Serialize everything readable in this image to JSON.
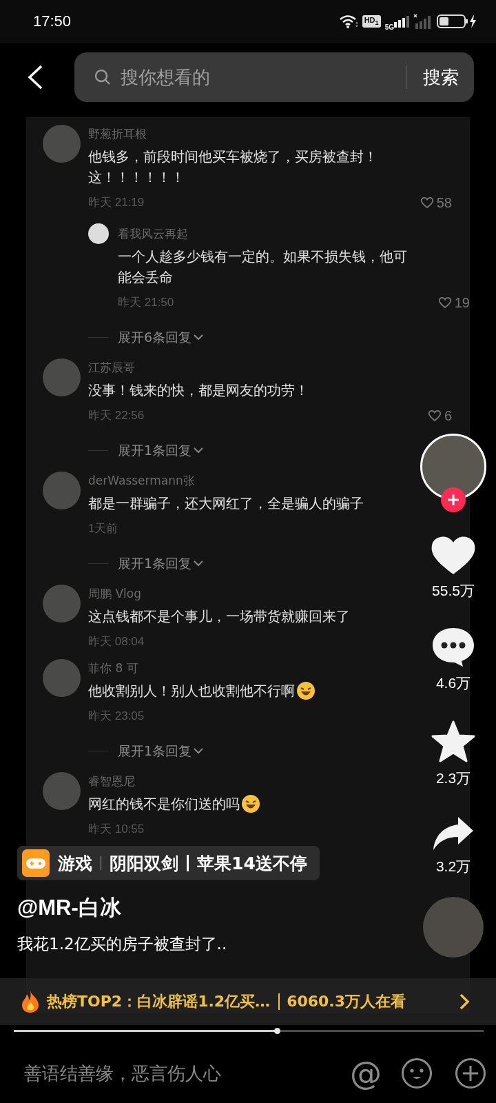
{
  "status_bar": {
    "time": "17:50",
    "hd_badge": "HD$_{1}$",
    "network": "5G"
  },
  "search": {
    "placeholder": "搜你想看的",
    "button": "搜索"
  },
  "comments": [
    {
      "name": "野葱折耳根",
      "text": "他钱多，前段时间他买车被烧了，买房被查封！这！！！！！！",
      "time": "昨天 21:19",
      "likes": "58",
      "replies": [
        {
          "name": "看我风云再起",
          "text": "一个人趁多少钱有一定的。如果不损失钱，他可能会丢命",
          "time": "昨天 21:50",
          "likes": "19"
        }
      ],
      "more": "展开6条回复"
    },
    {
      "name": "江苏辰哥",
      "text": "没事！钱来的快，都是网友的功劳！",
      "time": "昨天 22:56",
      "likes": "6",
      "more": "展开1条回复"
    },
    {
      "name": "derWassermann张",
      "text": "都是一群骗子，还大网红了，全是骗人的骗子",
      "time": "1天前",
      "more": "展开1条回复"
    },
    {
      "name": "周鹏 Vlog",
      "text": "这点钱都不是个事儿，一场带货就赚回来了",
      "time": "昨天 08:04"
    },
    {
      "name": "菲你 8 可",
      "text": "他收割别人！别人也收割他不行啊",
      "trailing_emoji": true,
      "time": "昨天 23:05",
      "more": "展开1条回复"
    },
    {
      "name": "睿智恩尼",
      "text": "网红的钱不是你们送的吗",
      "trailing_emoji": true,
      "time": "昨天 10:55"
    }
  ],
  "rail": {
    "likes": "55.5万",
    "comments": "4.6万",
    "favorites": "2.3万",
    "shares": "3.2万"
  },
  "tag": {
    "segments": [
      "游戏",
      "阴阳双剑",
      "苹果14送不停"
    ]
  },
  "author": "@MR-白冰",
  "caption": "我花1.2亿买的房子被查封了..",
  "hot": {
    "title": "热榜TOP2：白冰辟谣1.2亿买…",
    "viewers": "6060.3万人在看"
  },
  "progress": {
    "level": 0.56
  },
  "comment_input": {
    "placeholder": "善语结善缘，恶言伤人心",
    "mention": "@"
  }
}
